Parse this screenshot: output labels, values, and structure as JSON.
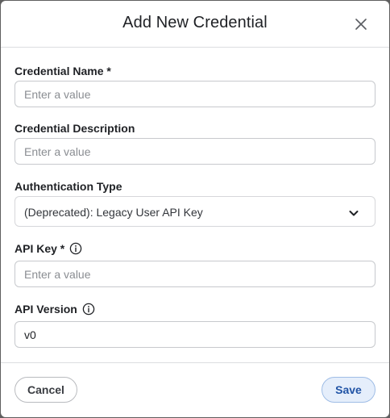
{
  "dialog": {
    "title": "Add New Credential",
    "close_icon": "close-icon"
  },
  "fields": {
    "credential_name": {
      "label": "Credential Name *",
      "placeholder": "Enter a value",
      "value": ""
    },
    "credential_description": {
      "label": "Credential Description",
      "placeholder": "Enter a value",
      "value": ""
    },
    "authentication_type": {
      "label": "Authentication Type",
      "selected": "(Deprecated): Legacy User API Key",
      "icon": "chevron-down-icon"
    },
    "api_key": {
      "label": "API Key *",
      "placeholder": "Enter a value",
      "value": "",
      "icon": "info-icon"
    },
    "api_version": {
      "label": "API Version",
      "placeholder": "",
      "value": "v0",
      "icon": "info-icon"
    }
  },
  "footer": {
    "cancel_label": "Cancel",
    "save_label": "Save"
  },
  "colors": {
    "overlay": "#5f5f5f",
    "save_bg": "#e5eefb",
    "save_text": "#2154a6",
    "save_border": "#9fbde6"
  }
}
